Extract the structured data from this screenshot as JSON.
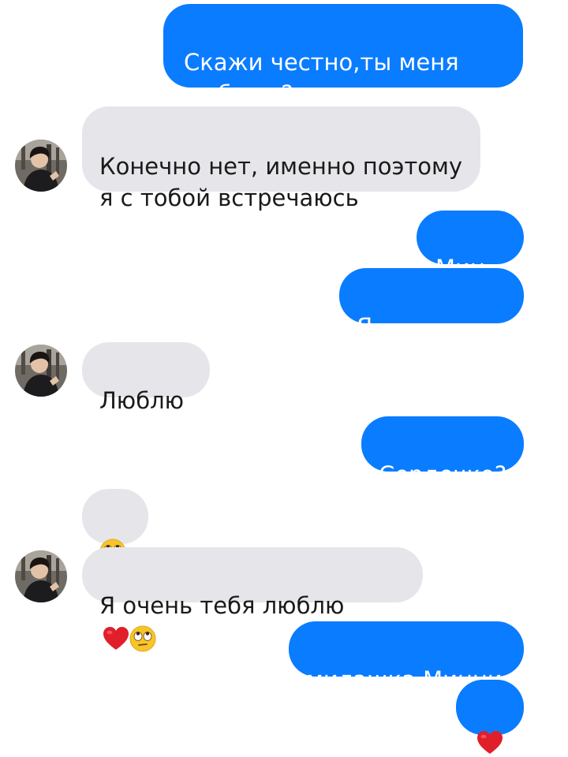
{
  "conversation": {
    "messages": [
      {
        "side": "sent",
        "text": "Скажи честно,ты меня\nлюбишь?"
      },
      {
        "side": "received",
        "text": "Конечно нет, именно поэтому\nя с тобой встречаюсь"
      },
      {
        "side": "sent",
        "text": "Мин..."
      },
      {
        "side": "sent",
        "text": "Я серьезно..."
      },
      {
        "side": "received",
        "text": "Люблю"
      },
      {
        "side": "sent",
        "text": "Сердечко?"
      },
      {
        "side": "received",
        "emoji": [
          "face-with-rolling-eyes-icon"
        ]
      },
      {
        "side": "received",
        "text": "Я очень тебя люблю",
        "emoji": [
          "red-heart-icon",
          "face-with-rolling-eyes-icon"
        ]
      },
      {
        "side": "sent",
        "text": "милашка Минни"
      },
      {
        "side": "sent",
        "emoji": [
          "red-heart-icon"
        ]
      }
    ]
  },
  "colors": {
    "sent_bubble": "#0a7cff",
    "received_bubble": "#e6e5ea",
    "sent_text": "#ffffff",
    "received_text": "#1a1a1a"
  }
}
